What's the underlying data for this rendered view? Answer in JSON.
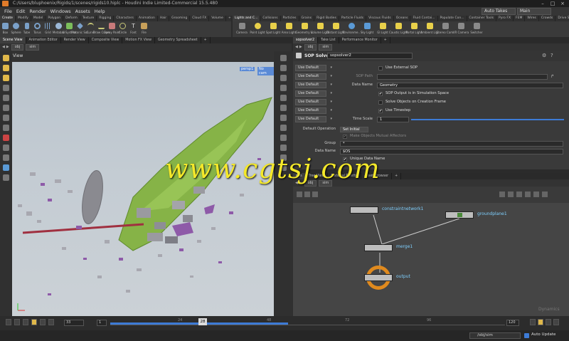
{
  "window": {
    "title": "C:/Users/bluphoenix/Rigids/1/scenes/rigids10.hiplc - Houdini Indie Limited-Commercial 15.5.480",
    "controls": [
      "–",
      "□",
      "×"
    ]
  },
  "menubar": {
    "items": [
      "File",
      "Edit",
      "Render",
      "Windows",
      "Assets",
      "Help"
    ],
    "autotakes": "Auto Takes",
    "desktop": "Main"
  },
  "shelf_left": {
    "tabs": [
      "Create",
      "Modify",
      "Model",
      "Polygon",
      "Deform",
      "Texture",
      "Rigging",
      "Characters",
      "Animation",
      "Hair",
      "Grooming",
      "Cloud FX",
      "Volume",
      "+"
    ],
    "tools": [
      "Box",
      "Sphere",
      "Tube",
      "Torus",
      "Grid",
      "Metaball",
      "L-System",
      "Platonic Sol.",
      "Curve",
      "Draw Curve",
      "Spray Paint",
      "Circle",
      "Font",
      "File"
    ]
  },
  "shelf_right": {
    "tabs": [
      "Lights and C...",
      "Collisions",
      "Particles",
      "Grains",
      "Rigid Bodies",
      "Particle Fluids",
      "Viscous Fluids",
      "Oceans",
      "Fluid Contai...",
      "Populate Con...",
      "Container Tools",
      "Pyro FX",
      "FEM",
      "Wires",
      "Crowds",
      "Drive Simula..."
    ],
    "tools": [
      "Camera",
      "Point Light",
      "Spot Light",
      "Area Light",
      "Geometry L.",
      "Volume Light",
      "Distant Light",
      "Environme..",
      "Sky Light",
      "GI Light",
      "Caustic Light",
      "Portal Light",
      "Ambient Lig.",
      "Stereo Cam.",
      "VR Camera",
      "Switcher"
    ]
  },
  "left_pane": {
    "tabs": [
      "Scene View",
      "Animation Editor",
      "Render View",
      "Composite View",
      "Motion FX View",
      "Geometry Spreadsheet",
      "+"
    ],
    "path": [
      "obj",
      "sim"
    ],
    "viewport_title": "View",
    "persp": "persp1",
    "cam": "No cam"
  },
  "params": {
    "tabs": [
      "sopsolver2",
      "Take List",
      "Performance Monitor",
      "+"
    ],
    "path": [
      "obj",
      "sim"
    ],
    "node_type": "SOP Solver",
    "node_name": "sopsolver2",
    "default_label": "Use Default",
    "rows": [
      {
        "label": "",
        "check": "Use External SOP",
        "checked": false
      },
      {
        "label": "SOP Path",
        "value": ""
      },
      {
        "label": "Data Name",
        "value": "Geometry"
      },
      {
        "label": "",
        "check": "SOP Output is in Simulation Space",
        "checked": true
      },
      {
        "label": "",
        "check": "Solve Objects on Creation Frame",
        "checked": false
      },
      {
        "label": "",
        "check": "Use Timestep",
        "checked": true
      },
      {
        "label": "Time Scale",
        "value": "1"
      }
    ],
    "default_operation_label": "Default Operation",
    "default_operation_value": "Set Initial",
    "make_objects_mutual": "Make Objects Mutual Affectors",
    "group_label": "Group",
    "group_value": "*",
    "data_name_label": "Data Name",
    "data_name_value": "$OS",
    "unique_data_name": "Unique Data Name"
  },
  "network": {
    "tabs": [
      "sim",
      "Tree View",
      "Material Palette",
      "Asset Browser",
      "+"
    ],
    "path": [
      "obj",
      "sim"
    ],
    "nodes": [
      {
        "name": "constraintnetwork1"
      },
      {
        "name": "groundplane1"
      },
      {
        "name": "merge1"
      },
      {
        "name": "output"
      }
    ],
    "corner_label": "Dynamics"
  },
  "watermark": "www.cgtsj.com",
  "timeline": {
    "current_frame": "28",
    "start": "1",
    "end": "120",
    "start_field": "33",
    "ticks": [
      "24",
      "48",
      "72",
      "96",
      "120"
    ],
    "end_field": "120"
  },
  "status": {
    "path": "/obj/sim",
    "auto_update": "Auto Update"
  },
  "colors": {
    "accent_blue": "#3d7bd6",
    "debris_green": "#86b347",
    "orange_flag": "#e08a1e"
  }
}
